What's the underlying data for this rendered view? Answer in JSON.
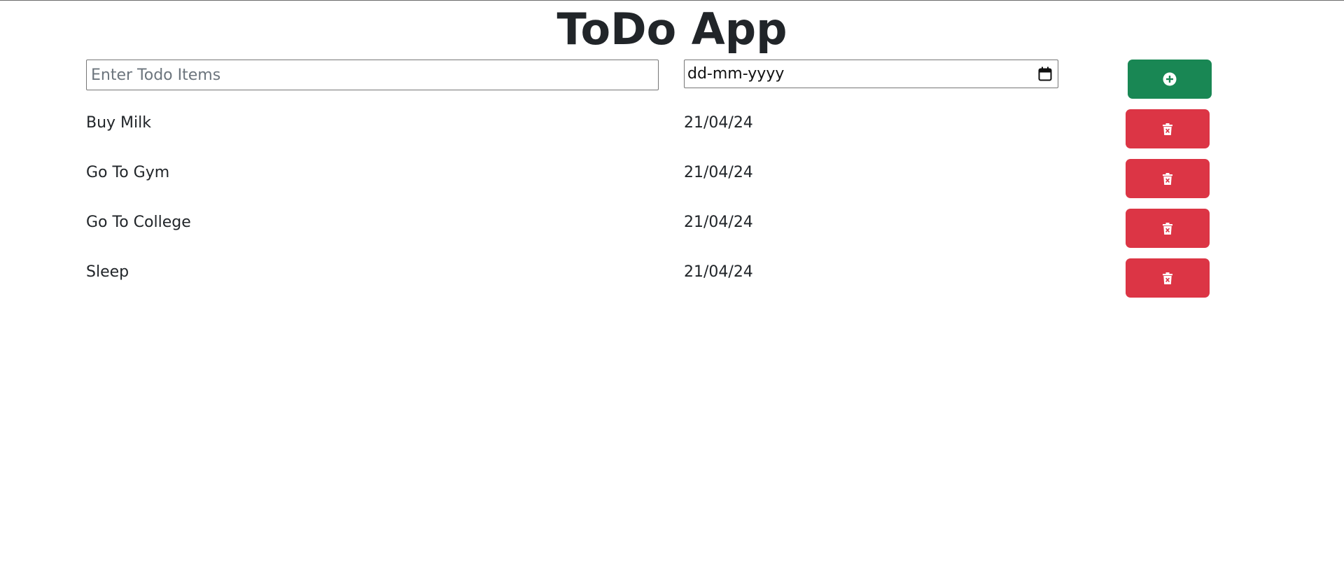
{
  "app": {
    "title": "ToDo App"
  },
  "form": {
    "todo_placeholder": "Enter Todo Items",
    "todo_value": "",
    "date_placeholder": "dd-mm-yyyy",
    "add_button_icon": "plus-circle-icon"
  },
  "todos": [
    {
      "name": "Buy Milk",
      "date": "21/04/24"
    },
    {
      "name": "Go To Gym",
      "date": "21/04/24"
    },
    {
      "name": "Go To College",
      "date": "21/04/24"
    },
    {
      "name": "Sleep",
      "date": "21/04/24"
    }
  ],
  "icons": {
    "delete_button_icon": "trash-x-icon",
    "date_icon": "calendar-icon"
  },
  "colors": {
    "add_button": "#198754",
    "delete_button": "#dc3545",
    "text": "#212529"
  }
}
